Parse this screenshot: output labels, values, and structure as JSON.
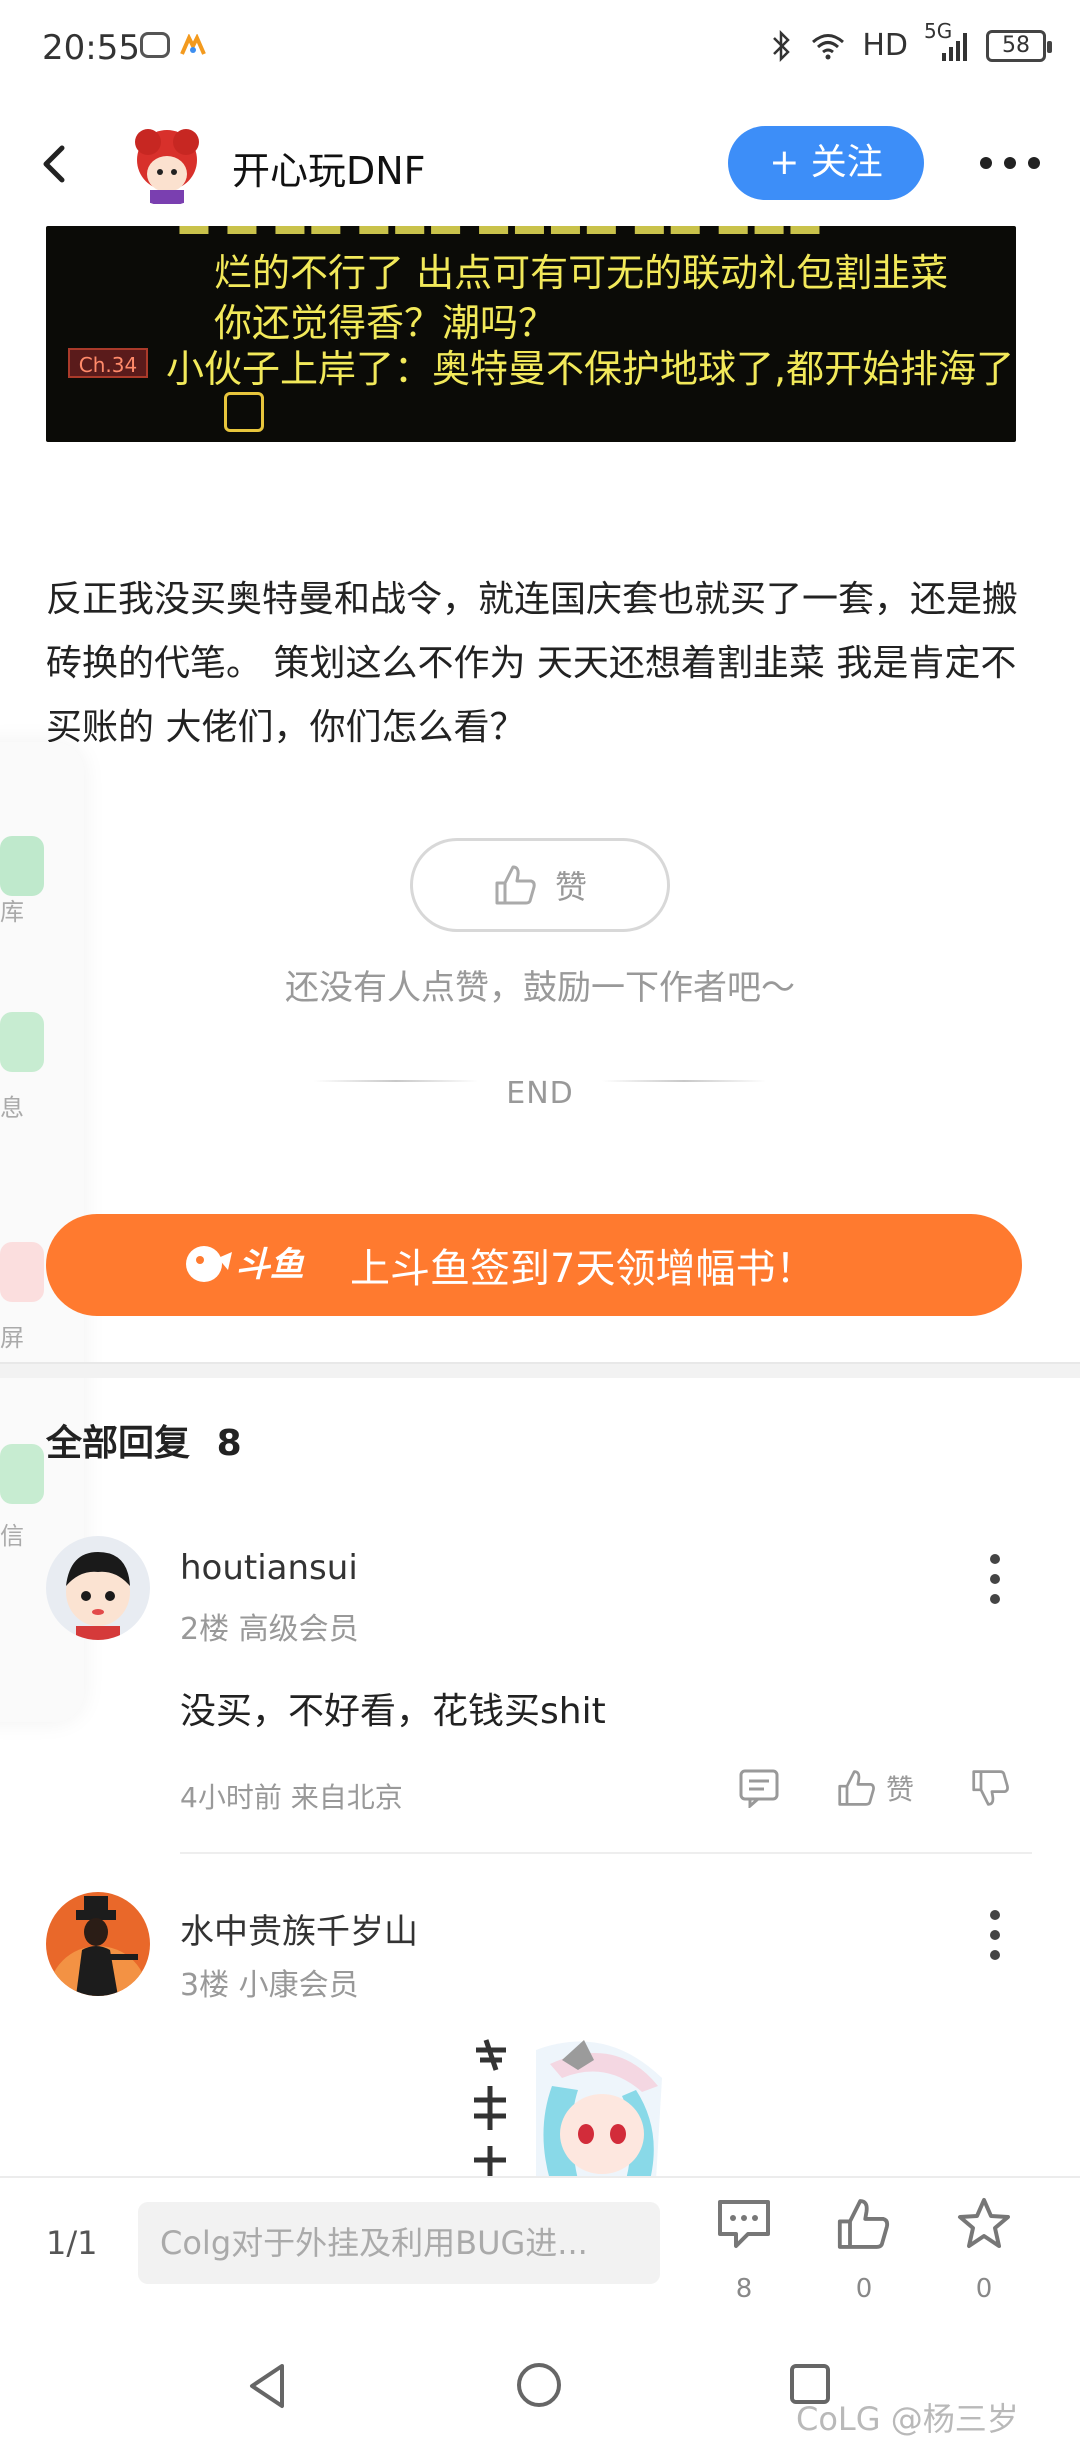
{
  "status_bar": {
    "time": "20:55",
    "network": "HD",
    "signal": "5G",
    "battery": "58"
  },
  "header": {
    "forum_name": "开心玩DNF",
    "follow_label": "+ 关注"
  },
  "post": {
    "image_lines": [
      "烂的不行了  出点可有可无的联动礼包割韭菜",
      "你还觉得香？潮吗？",
      "小伙子上岸了：奥特曼不保护地球了,都开始排海了"
    ],
    "image_tag": "Ch.34",
    "text": "反正我没买奥特曼和战令，就连国庆套也就买了一套，还是搬砖换的代笔。 策划这么不作为   天天还想着割韭菜  我是肯定不买账的     大佬们，你们怎么看？"
  },
  "side_panel": {
    "items": [
      "库",
      "息",
      "屏",
      "信"
    ]
  },
  "like": {
    "label": "赞",
    "hint": "还没有人点赞，鼓励一下作者吧～",
    "end": "END"
  },
  "banner": {
    "logo_text": "斗鱼",
    "text": "上斗鱼签到7天领增幅书！"
  },
  "replies": {
    "title": "全部回复",
    "count": "8",
    "comments": [
      {
        "name": "houtiansui",
        "meta": "2楼 高级会员",
        "text": "没买，不好看，花钱买shit",
        "foot": "4小时前 来自北京",
        "like_label": "赞"
      },
      {
        "name": "水中贵族千岁山",
        "meta": "3楼 小康会员"
      }
    ]
  },
  "bottom_bar": {
    "pager": "1/1",
    "input_placeholder": "Colg对于外挂及利用BUG进...",
    "comment_count": "8",
    "like_count": "0",
    "star_count": "0"
  },
  "watermark": "CoLG @杨三岁",
  "colors": {
    "follow_blue": "#3d8ef8",
    "banner_orange": "#ff7a2f",
    "image_text_yellow": "#f2e95a"
  }
}
